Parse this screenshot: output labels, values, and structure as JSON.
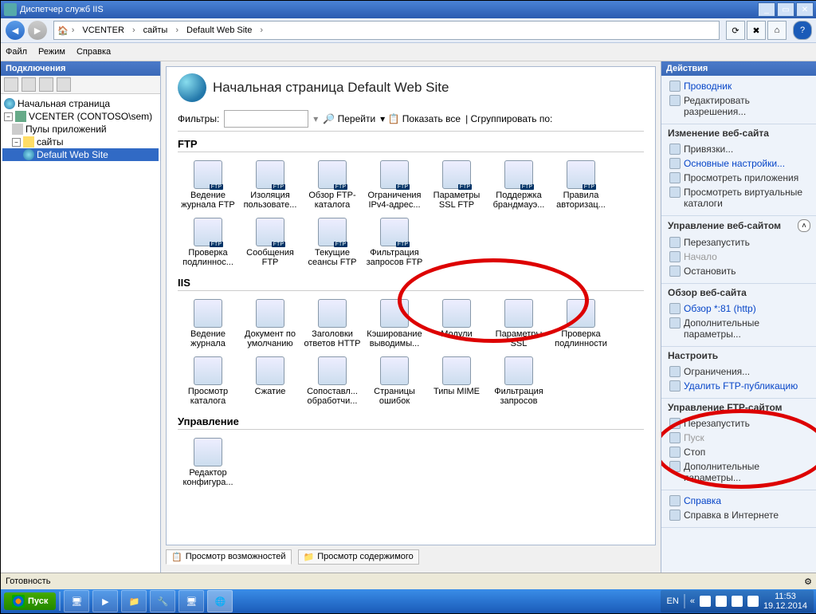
{
  "window": {
    "title": "Диспетчер служб IIS"
  },
  "breadcrumb": {
    "items": [
      "VCENTER",
      "сайты",
      "Default Web Site"
    ]
  },
  "menu": {
    "file": "Файл",
    "mode": "Режим",
    "help": "Справка"
  },
  "left": {
    "header": "Подключения",
    "tree": {
      "start": "Начальная страница",
      "server": "VCENTER (CONTOSO\\sem)",
      "app_pools": "Пулы приложений",
      "sites": "сайты",
      "default_site": "Default Web Site"
    }
  },
  "center": {
    "title": "Начальная страница Default Web Site",
    "filters_label": "Фильтры:",
    "go": "Перейти",
    "show_all": "Показать все",
    "group_by": "Сгруппировать по:",
    "groups": {
      "ftp": {
        "title": "FTP",
        "items": [
          "Ведение журнала FTP",
          "Изоляция пользовате...",
          "Обзор FTP-каталога",
          "Ограничения IPv4-адрес...",
          "Параметры SSL FTP",
          "Поддержка брандмауэ...",
          "Правила авторизац...",
          "Проверка подлиннос...",
          "Сообщения FTP",
          "Текущие сеансы FTP",
          "Фильтрация запросов FTP"
        ]
      },
      "iis": {
        "title": "IIS",
        "items": [
          "Ведение журнала",
          "Документ по умолчанию",
          "Заголовки ответов HTTP",
          "Кэширование выводимы...",
          "Модули",
          "Параметры SSL",
          "Проверка подлинности",
          "Просмотр каталога",
          "Сжатие",
          "Сопоставл... обработчи...",
          "Страницы ошибок",
          "Типы MIME",
          "Фильтрация запросов"
        ]
      },
      "management": {
        "title": "Управление",
        "items": [
          "Редактор конфигура..."
        ]
      }
    },
    "tabs": {
      "features": "Просмотр возможностей",
      "content": "Просмотр содержимого"
    }
  },
  "right": {
    "header": "Действия",
    "explorer": "Проводник",
    "edit_permissions": "Редактировать разрешения...",
    "edit_site_title": "Изменение веб-сайта",
    "bindings": "Привязки...",
    "basic_settings": "Основные настройки...",
    "view_apps": "Просмотреть приложения",
    "view_vdirs": "Просмотреть виртуальные каталоги",
    "manage_site_title": "Управление веб-сайтом",
    "restart_web": "Перезапустить",
    "start_web": "Начало",
    "stop_web": "Остановить",
    "browse_title": "Обзор веб-сайта",
    "browse_link": "Обзор *:81 (http)",
    "adv_params": "Дополнительные параметры...",
    "configure_title": "Настроить",
    "limits": "Ограничения...",
    "remove_ftp": "Удалить FTP-публикацию",
    "manage_ftp_title": "Управление FTP-сайтом",
    "restart_ftp": "Перезапустить",
    "start_ftp": "Пуск",
    "stop_ftp": "Стоп",
    "adv_params2": "Дополнительные параметры...",
    "help": "Справка",
    "help_online": "Справка в Интернете"
  },
  "status": {
    "ready": "Готовность"
  },
  "taskbar": {
    "start": "Пуск",
    "lang": "EN",
    "time": "11:53",
    "date": "19.12.2014"
  }
}
